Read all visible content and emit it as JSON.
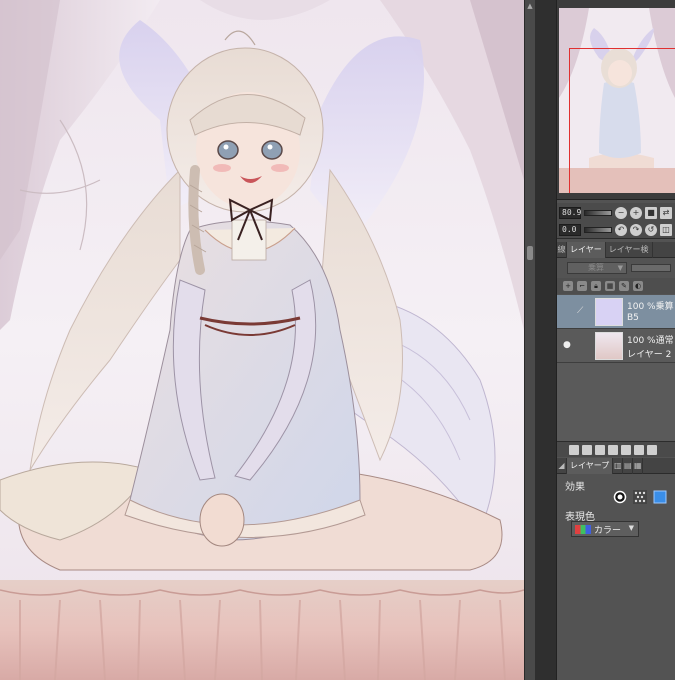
{
  "navigator": {
    "zoom_value": "80.9",
    "angle_value": "0.0"
  },
  "palette_tabs": {
    "tab1": "線",
    "tab2": "レイヤー",
    "tab3": "レイヤー検"
  },
  "blend_mode": {
    "selected": "乗算"
  },
  "layers": [
    {
      "blend": "100 %乗算",
      "name": "B5",
      "selected": true,
      "visible": false
    },
    {
      "blend": "100 %通常",
      "name": "レイヤー 2",
      "selected": false,
      "visible": true
    }
  ],
  "property_tabs": {
    "tab1": "レイヤープ"
  },
  "properties": {
    "effect_label": "効果",
    "expression_color_label": "表現色",
    "expression_color_value": "カラー"
  },
  "colors": {
    "panel_bg": "#535353",
    "selected_layer": "#7d8fa0",
    "navigator_frame": "#e03030"
  },
  "icons": [
    "zoom-out-icon",
    "zoom-in-icon",
    "fit-icon",
    "flip-icon",
    "rotate-left-icon",
    "rotate-right-icon",
    "reset-icon",
    "eye-icon",
    "link-icon",
    "new-layer-icon",
    "delete-layer-icon",
    "outline-effect-icon",
    "tone-effect-icon",
    "color-effect-icon"
  ]
}
